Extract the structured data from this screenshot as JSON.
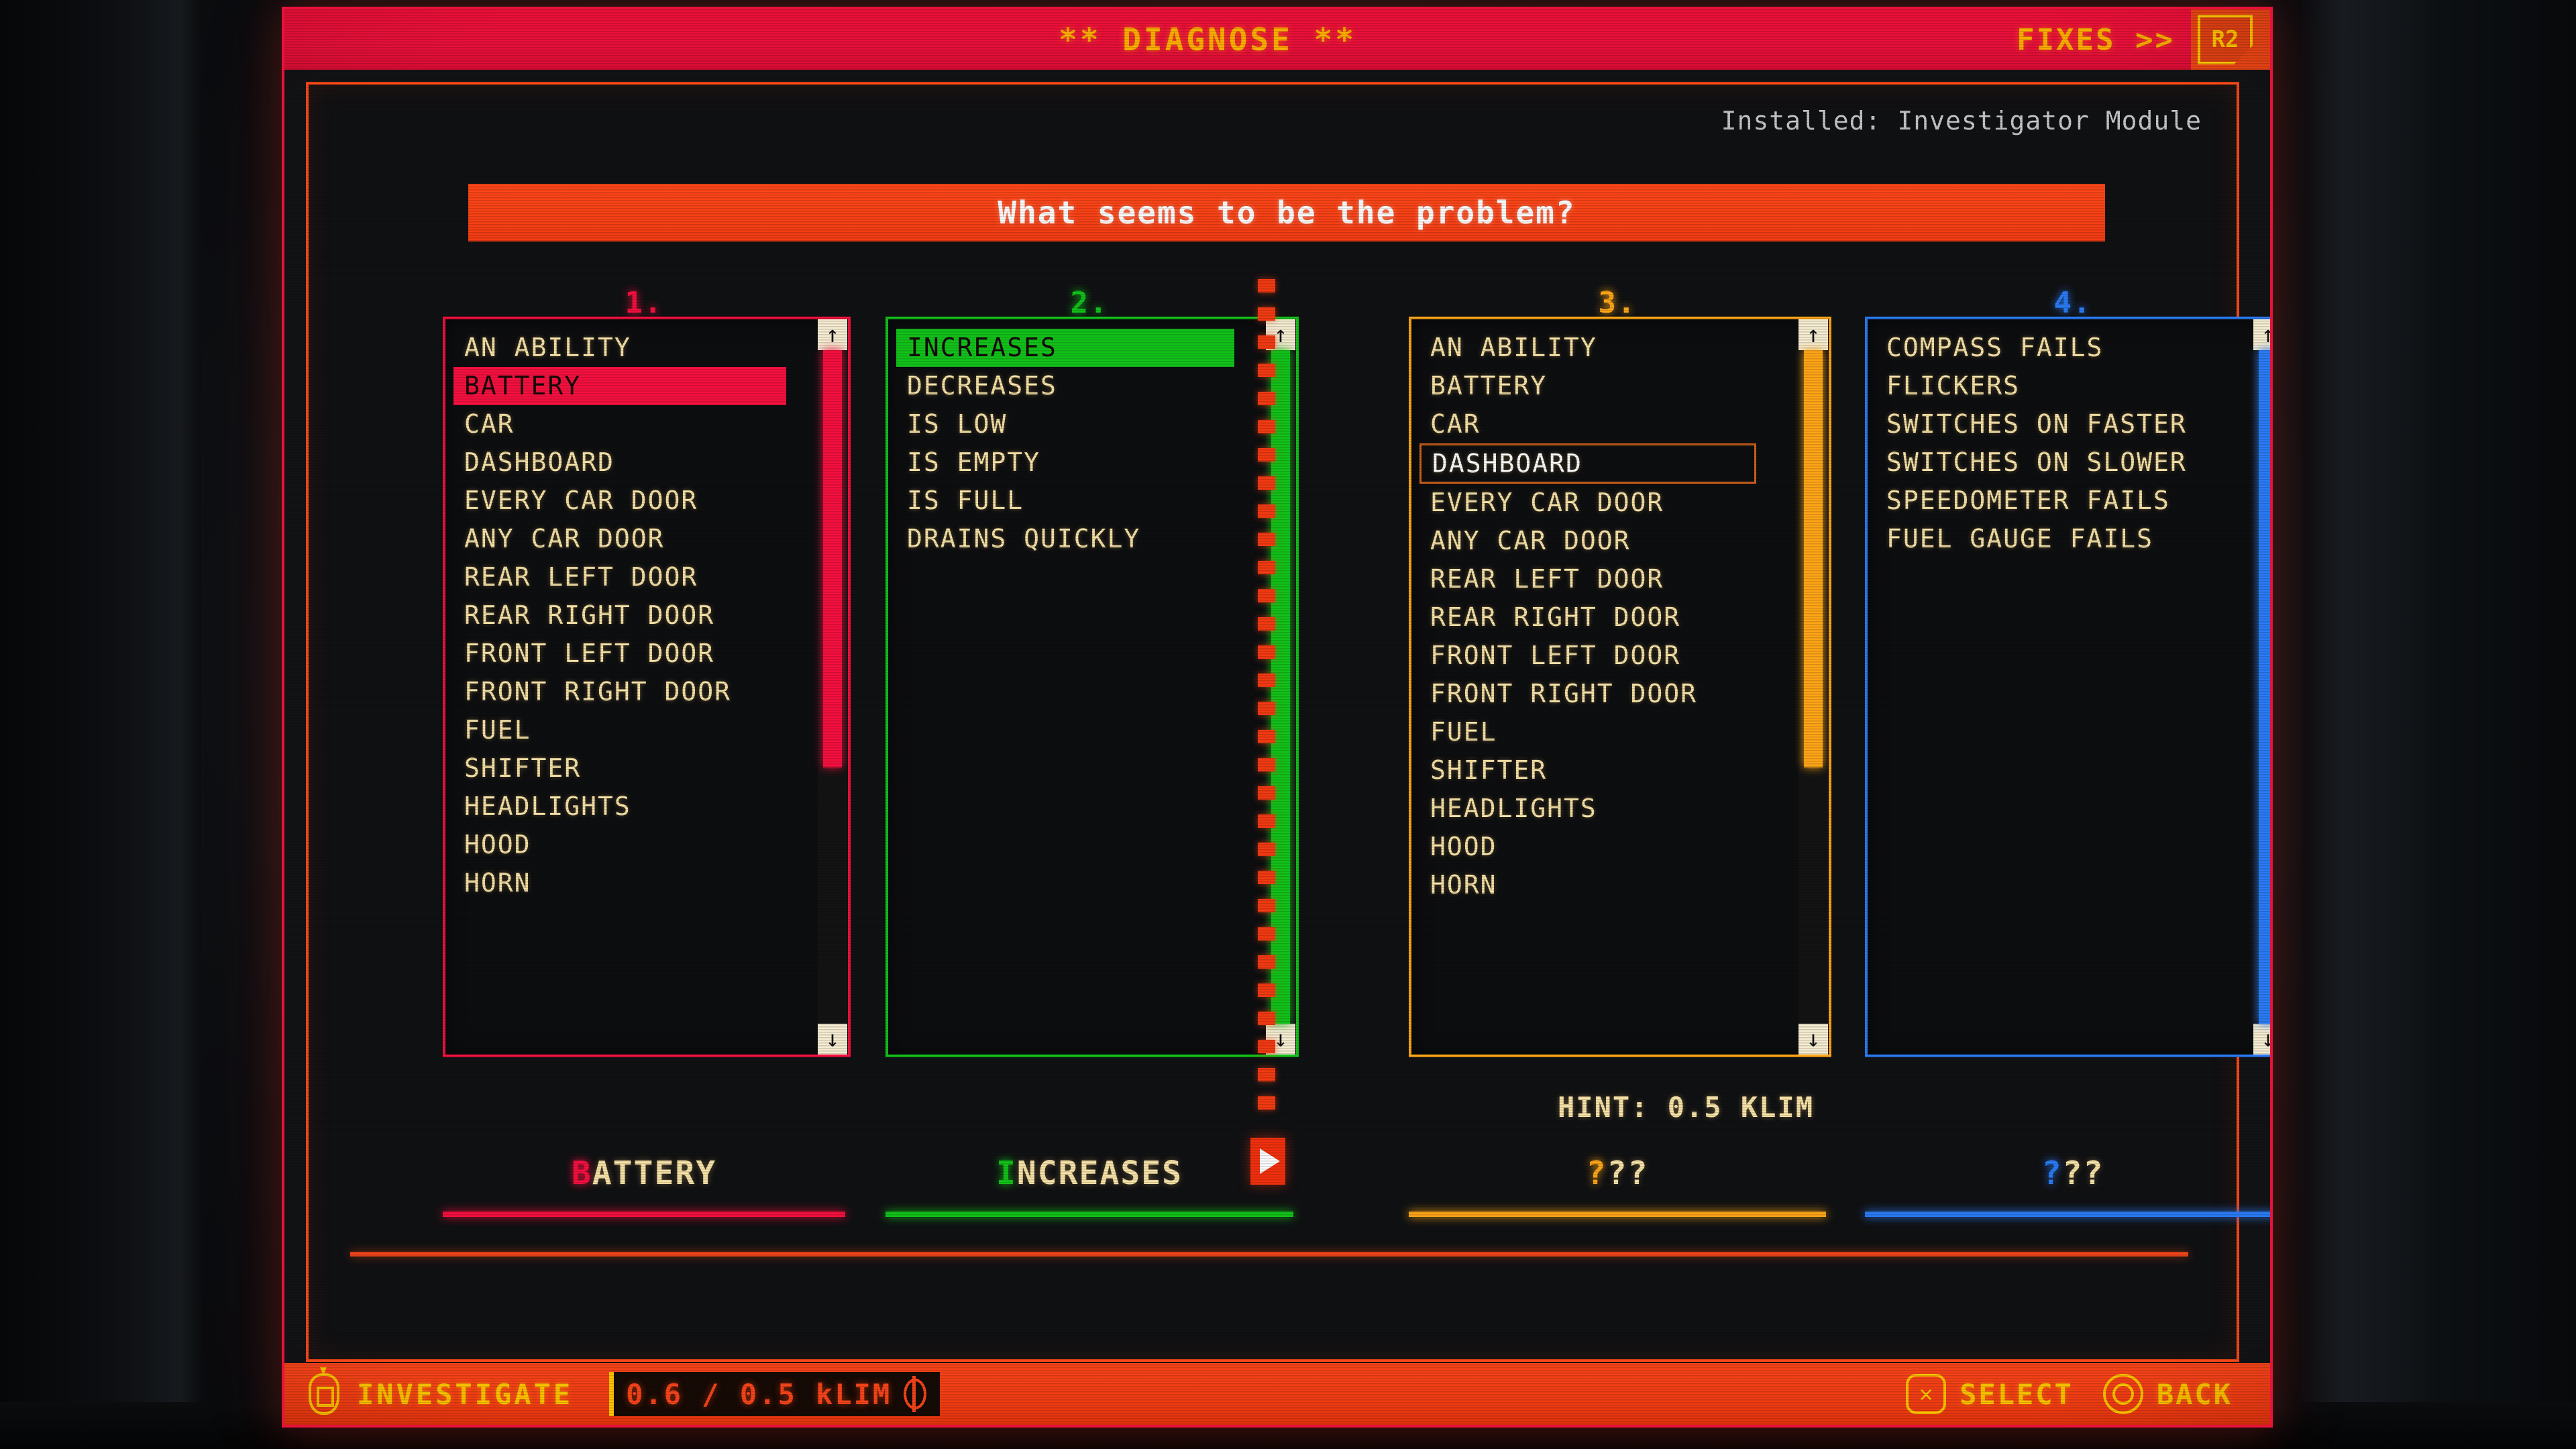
{
  "header": {
    "title": "** DIAGNOSE **",
    "fixes_label": "FIXES >>",
    "r2_key": "R2"
  },
  "panel": {
    "installed": "Installed: Investigator Module",
    "question": "What seems to be the problem?",
    "hint": "HINT: 0.5 KLIM"
  },
  "colors": {
    "col1": "#f5103f",
    "col2": "#12c21a",
    "col3": "#ffa617",
    "col4": "#2a7bf5",
    "item_text": "#f7e3a8",
    "accent_red": "#f8441a",
    "accent_yellow": "#ffc400",
    "screen_bg": "#101113"
  },
  "columns": [
    {
      "number": "1.",
      "color": "#f5103f",
      "selection_style": "fill",
      "selected_index": 1,
      "scroll": {
        "thumb_top_pct": 0,
        "thumb_height_pct": 62
      },
      "items": [
        "AN ABILITY",
        "BATTERY",
        "CAR",
        "DASHBOARD",
        "EVERY CAR DOOR",
        "ANY CAR DOOR",
        "REAR LEFT DOOR",
        "REAR RIGHT DOOR",
        "FRONT LEFT DOOR",
        "FRONT RIGHT DOOR",
        "FUEL",
        "SHIFTER",
        "HEADLIGHTS",
        "HOOD",
        "HORN"
      ]
    },
    {
      "number": "2.",
      "color": "#12c21a",
      "selection_style": "fill",
      "selected_index": 0,
      "scroll": {
        "thumb_top_pct": 0,
        "thumb_height_pct": 100
      },
      "items": [
        "INCREASES",
        "DECREASES",
        "IS LOW",
        "IS EMPTY",
        "IS FULL",
        "DRAINS QUICKLY"
      ]
    },
    {
      "number": "3.",
      "color": "#ffa617",
      "selection_style": "outline",
      "selected_index": 3,
      "scroll": {
        "thumb_top_pct": 0,
        "thumb_height_pct": 62
      },
      "items": [
        "AN ABILITY",
        "BATTERY",
        "CAR",
        "DASHBOARD",
        "EVERY CAR DOOR",
        "ANY CAR DOOR",
        "REAR LEFT DOOR",
        "REAR RIGHT DOOR",
        "FRONT LEFT DOOR",
        "FRONT RIGHT DOOR",
        "FUEL",
        "SHIFTER",
        "HEADLIGHTS",
        "HOOD",
        "HORN"
      ]
    },
    {
      "number": "4.",
      "color": "#2a7bf5",
      "selection_style": "none",
      "selected_index": -1,
      "scroll": {
        "thumb_top_pct": 0,
        "thumb_height_pct": 100
      },
      "items": [
        "COMPASS FAILS",
        "FLICKERS",
        "SWITCHES ON FASTER",
        "SWITCHES ON SLOWER",
        "SPEEDOMETER FAILS",
        "FUEL GAUGE FAILS"
      ]
    }
  ],
  "answers": [
    {
      "first": "B",
      "rest": "ATTERY",
      "color": "#f5103f"
    },
    {
      "first": "I",
      "rest": "NCREASES",
      "color": "#12c21a"
    },
    {
      "first": "?",
      "rest": "??",
      "color": "#ffa617"
    },
    {
      "first": "?",
      "rest": "??",
      "color": "#2a7bf5"
    }
  ],
  "statusbar": {
    "investigate_label": "INVESTIGATE",
    "money": "0.6 / 0.5 kLIM",
    "select_label": "SELECT",
    "back_label": "BACK",
    "select_glyph": "✕",
    "scrollbar_up": "↑",
    "scrollbar_down": "↓"
  }
}
